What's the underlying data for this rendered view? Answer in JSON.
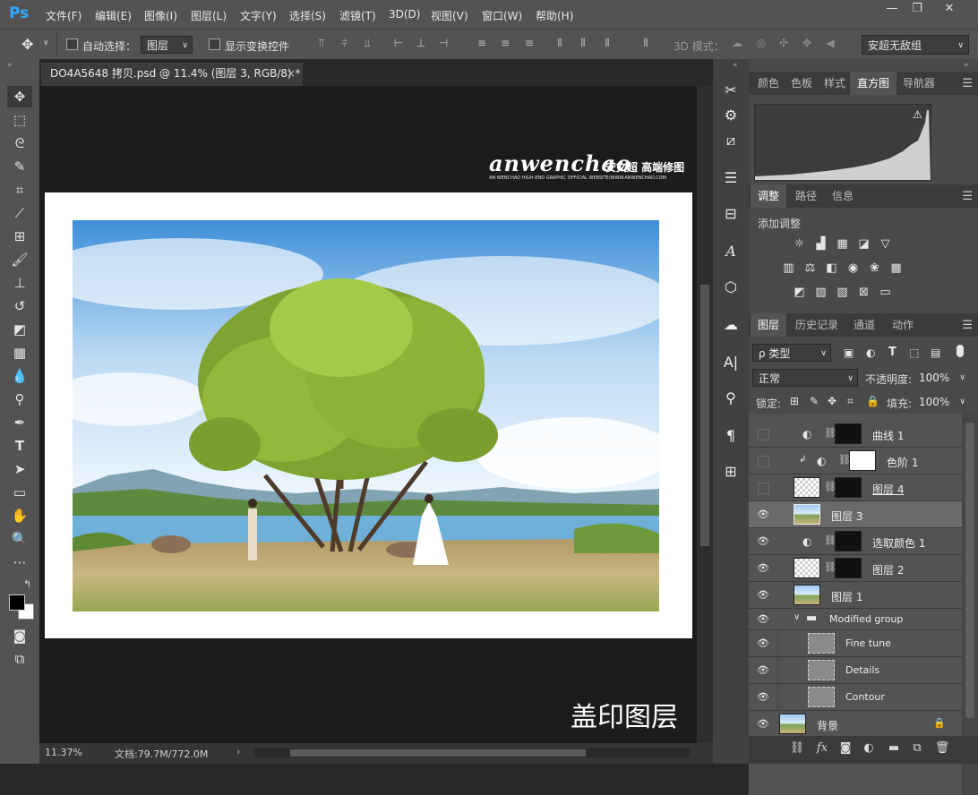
{
  "app": {
    "logo": "Ps"
  },
  "menus": [
    "文件(F)",
    "编辑(E)",
    "图像(I)",
    "图层(L)",
    "文字(Y)",
    "选择(S)",
    "滤镜(T)",
    "3D(D)",
    "视图(V)",
    "窗口(W)",
    "帮助(H)"
  ],
  "window_controls": {
    "minimize": "—",
    "maximize": "❐",
    "close": "✕"
  },
  "options": {
    "auto_select_label": "自动选择：",
    "auto_select_value": "图层",
    "show_transform_label": "显示变换控件",
    "mode_3d_label": "3D 模式：",
    "workspace_value": "安超无敌组"
  },
  "document": {
    "tab_title": "DO4A5648 拷贝.psd @ 11.4% (图层 3, RGB/8) *",
    "tab_close": "×",
    "watermark_brand": "anwenchao",
    "watermark_cn": "安文超 高端修图",
    "watermark_sub": "AN WENCHAO HIGH-END GRAPHIC OFFICIAL WEBSITE/WWW.ANWENCHAO.COM",
    "caption": "盖印图层"
  },
  "status": {
    "zoom": "11.37%",
    "doc_info": "文档:79.7M/772.0M",
    "arrow": "›"
  },
  "panel_top": {
    "tabs": [
      "颜色",
      "色板",
      "样式",
      "直方图",
      "导航器"
    ],
    "active": "直方图",
    "warning": "⚠"
  },
  "panel_adjust": {
    "tabs": [
      "调整",
      "路径",
      "信息"
    ],
    "active": "调整",
    "title": "添加调整"
  },
  "panel_layers": {
    "tabs": [
      "图层",
      "历史记录",
      "通道",
      "动作"
    ],
    "active": "图层",
    "filter_label": "ρ 类型",
    "blend_mode": "正常",
    "opacity_label": "不透明度:",
    "opacity_value": "100%",
    "lock_label": "锁定:",
    "fill_label": "填充:",
    "fill_value": "100%",
    "layers": [
      {
        "name": "曲线 1",
        "visible": false
      },
      {
        "name": "色阶 1",
        "visible": false
      },
      {
        "name": "图层 4",
        "visible": false
      },
      {
        "name": "图层 3",
        "visible": true
      },
      {
        "name": "选取颜色 1",
        "visible": true
      },
      {
        "name": "图层 2",
        "visible": true
      },
      {
        "name": "图层 1",
        "visible": true
      },
      {
        "name": "Modified group",
        "visible": true
      },
      {
        "name": "Fine tune",
        "visible": true
      },
      {
        "name": "Details",
        "visible": true
      },
      {
        "name": "Contour",
        "visible": true
      },
      {
        "name": "背景",
        "visible": true
      }
    ]
  },
  "icons": {
    "eye": "👁",
    "chain": "⛓",
    "lock": "🔒"
  }
}
